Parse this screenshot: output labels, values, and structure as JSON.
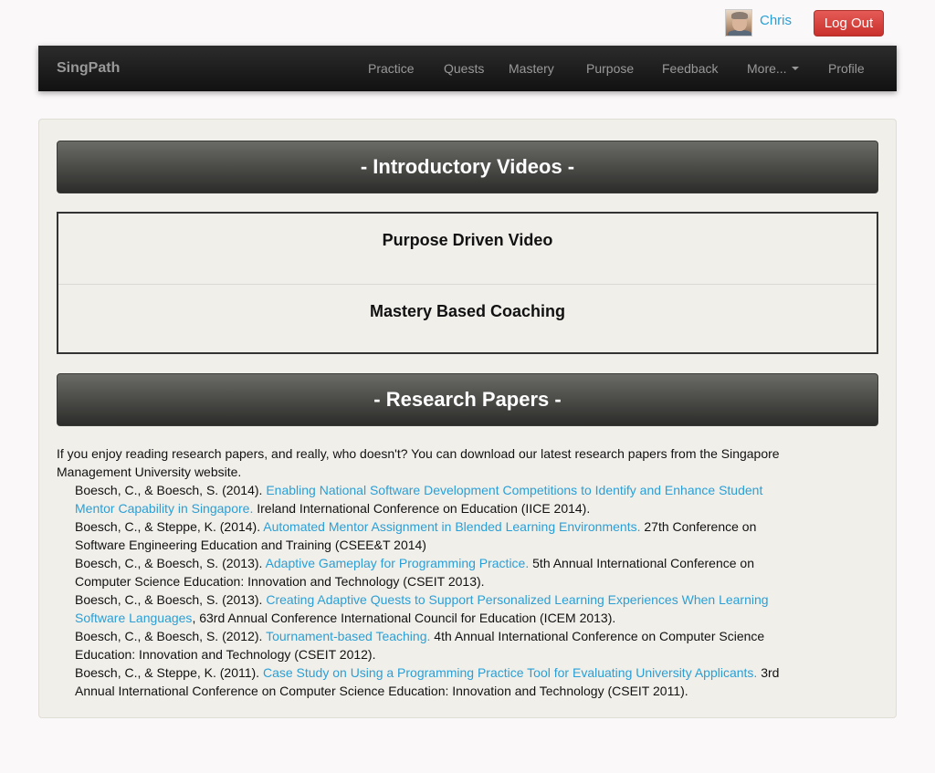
{
  "user": {
    "name": "Chris",
    "logout_label": "Log Out"
  },
  "navbar": {
    "brand": "SingPath",
    "items": [
      "Practice",
      "Quests",
      "Mastery",
      "Purpose",
      "Feedback",
      "More...",
      "Profile"
    ]
  },
  "videos": {
    "header": "- Introductory Videos -",
    "items": [
      "Purpose Driven Video",
      "Mastery Based Coaching"
    ]
  },
  "research": {
    "header": "- Research Papers -",
    "intro": "If you enjoy reading research papers, and really, who doesn't? You can download our latest research papers from the Singapore Management University website.",
    "papers": [
      {
        "authors": "Boesch, C., & Boesch, S. (2014). ",
        "title": "Enabling National Software Development Competitions to Identify and Enhance Student Mentor Capability in Singapore.",
        "venue": " Ireland International Conference on Education (IICE 2014)."
      },
      {
        "authors": "Boesch, C., & Steppe, K. (2014). ",
        "title": "Automated Mentor Assignment in Blended Learning Environments.",
        "venue": " 27th Conference on Software Engineering Education and Training (CSEE&T 2014)"
      },
      {
        "authors": "Boesch, C., & Boesch, S. (2013). ",
        "title": "Adaptive Gameplay for Programming Practice.",
        "venue": " 5th Annual International Conference on Computer Science Education: Innovation and Technology (CSEIT 2013)."
      },
      {
        "authors": "Boesch, C., & Boesch, S. (2013). ",
        "title": "Creating Adaptive Quests to Support Personalized Learning Experiences When Learning Software Languages",
        "venue": ", 63rd Annual Conference International Council for Education (ICEM 2013)."
      },
      {
        "authors": "Boesch, C., & Boesch, S. (2012). ",
        "title": "Tournament-based Teaching.",
        "venue": " 4th Annual International Conference on Computer Science Education: Innovation and Technology (CSEIT 2012)."
      },
      {
        "authors": "Boesch, C., & Steppe, K. (2011). ",
        "title": "Case Study on Using a Programming Practice Tool for Evaluating University Applicants.",
        "venue": " 3rd Annual International Conference on Computer Science Education: Innovation and Technology (CSEIT 2011)."
      }
    ]
  }
}
